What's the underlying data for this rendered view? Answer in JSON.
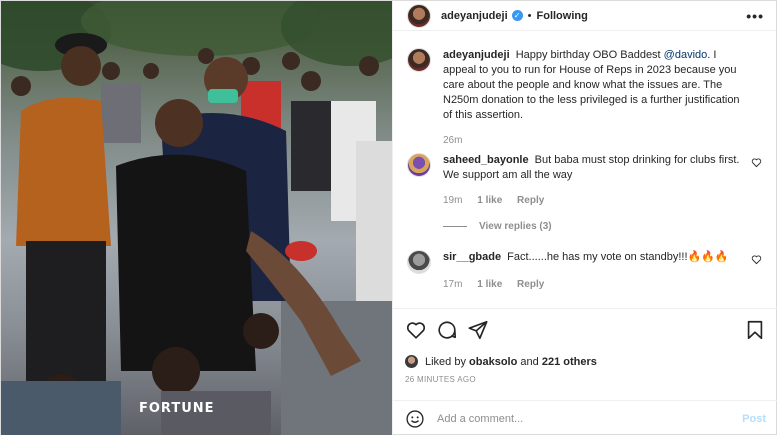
{
  "photo": {
    "watermark": "FORTUNE"
  },
  "header": {
    "username": "adeyanjudeji",
    "verified": true,
    "separator": "•",
    "follow_status": "Following",
    "more": "•••"
  },
  "caption": {
    "username": "adeyanjudeji",
    "text_before_mention": "Happy birthday OBO Baddest ",
    "mention": "@davido",
    "text_after_mention": ". I appeal to you to run for House of Reps in 2023 because you care about the people and know what the issues are. The N250m donation to the less privileged is a further justification of this assertion.",
    "time": "26m"
  },
  "comments": [
    {
      "username": "saheed_bayonle",
      "text": "But baba must stop drinking for clubs first. We support am all the way",
      "time": "19m",
      "likes": "1 like",
      "reply_label": "Reply",
      "view_replies": "View replies (3)"
    },
    {
      "username": "sir__gbade",
      "text": "Fact......he has my vote on standby!!!🔥🔥🔥",
      "time": "17m",
      "likes": "1 like",
      "reply_label": "Reply"
    }
  ],
  "actions": {
    "liked_by_prefix": "Liked by ",
    "liked_by_user": "obaksolo",
    "liked_by_and": " and ",
    "liked_by_others": "221 others",
    "timestamp": "26 MINUTES AGO"
  },
  "add_comment": {
    "placeholder": "Add a comment...",
    "post_label": "Post"
  },
  "colors": {
    "link": "#00376b",
    "verified_blue": "#3897f0",
    "muted": "#8e8e8e",
    "post_disabled": "#b2dffc"
  },
  "icons": [
    "heart-icon",
    "comment-icon",
    "share-icon",
    "bookmark-icon",
    "smile-icon",
    "more-icon",
    "verified-icon"
  ]
}
